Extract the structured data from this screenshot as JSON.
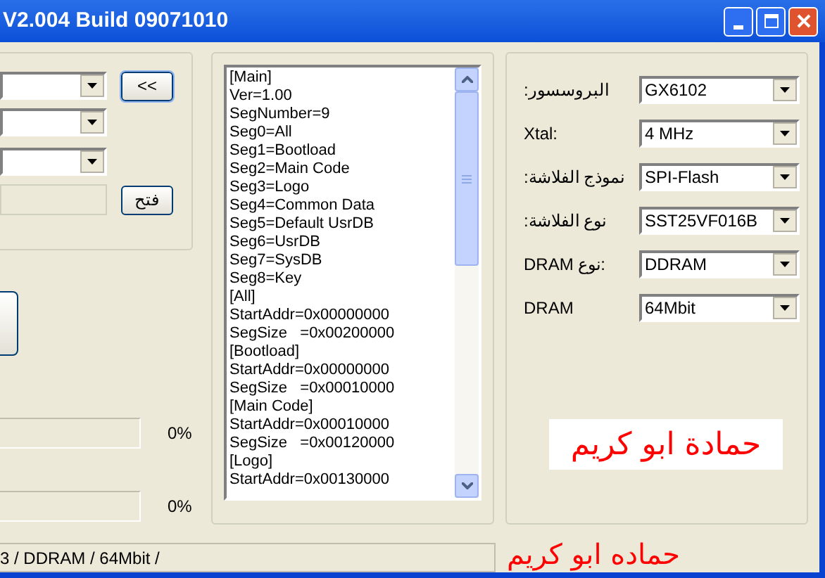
{
  "window": {
    "title": "V2.004 Build 09071010"
  },
  "left_panel": {
    "buttons": [
      "<<",
      "فتح"
    ],
    "progress": [
      {
        "level": 0,
        "reading": "0%"
      },
      {
        "level": 0,
        "reading": "0%"
      }
    ]
  },
  "config_list": {
    "lines": [
      "[Main]",
      "Ver=1.00",
      "SegNumber=9",
      "Seg0=All",
      "Seg1=Bootload",
      "Seg2=Main Code",
      "Seg3=Logo",
      "Seg4=Common Data",
      "Seg5=Default UsrDB",
      "Seg6=UsrDB",
      "Seg7=SysDB",
      "Seg8=Key",
      "[All]",
      "StartAddr=0x00000000",
      "SegSize   =0x00200000",
      "[Bootload]",
      "StartAddr=0x00000000",
      "SegSize   =0x00010000",
      "[Main Code]",
      "StartAddr=0x00010000",
      "SegSize   =0x00120000",
      "[Logo]",
      "StartAddr=0x00130000"
    ]
  },
  "settings": {
    "rows": [
      {
        "label": ":البروسسور",
        "value": "GX6102"
      },
      {
        "label": "Xtal:",
        "value": "4 MHz"
      },
      {
        "label": ":نموذج الفلاشة",
        "value": "SPI-Flash"
      },
      {
        "label": ":نوع الفلاشة",
        "value": "SST25VF016B"
      },
      {
        "label": "DRAM نوع:",
        "value": "DDRAM"
      },
      {
        "label": "DRAM",
        "value": "64Mbit"
      }
    ],
    "signature": "حمادة ابو كريم"
  },
  "status_bar": {
    "text": "3 / DDRAM / 64Mbit /",
    "overlay_text": "حماده ابو كريم"
  }
}
